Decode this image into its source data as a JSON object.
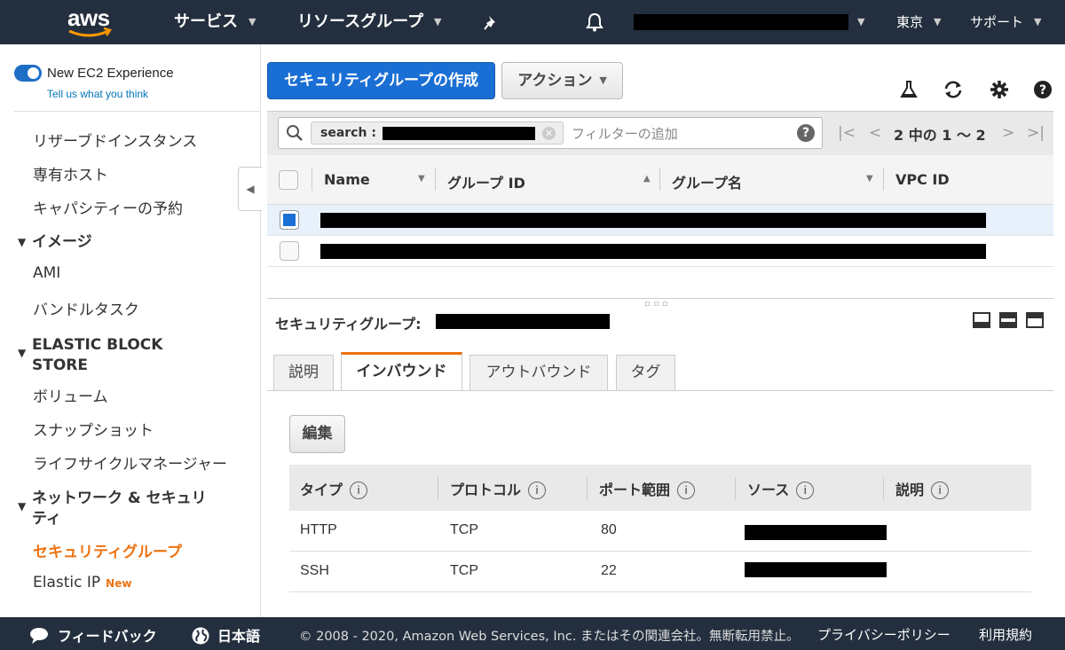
{
  "topnav": {
    "logo": "aws",
    "services": "サービス",
    "resource_groups": "リソースグループ",
    "region": "東京",
    "support": "サポート",
    "icons": [
      "pin-icon",
      "bell-icon"
    ]
  },
  "sidebar": {
    "experience_label": "New EC2 Experience",
    "experience_link": "Tell us what you think",
    "items": {
      "reserved": "リザーブドインスタンス",
      "dedicated": "専有ホスト",
      "capacity": "キャパシティーの予約",
      "images_head": "イメージ",
      "ami": "AMI",
      "bundle": "バンドルタスク",
      "ebs_head_1": "ELASTIC BLOCK",
      "ebs_head_2": "STORE",
      "volumes": "ボリューム",
      "snapshots": "スナップショット",
      "lifecycle": "ライフサイクルマネージャー",
      "netsec_head_1": "ネットワーク & セキュリ",
      "netsec_head_2": "ティ",
      "security_groups": "セキュリティグループ",
      "elastic_ip": "Elastic IP",
      "new_badge": "New"
    }
  },
  "toolbar": {
    "create_label": "セキュリティグループの作成",
    "actions_label": "アクション"
  },
  "filter": {
    "token_label": "search :",
    "placeholder": "フィルターの追加",
    "pager_text": "2 中の 1 ～ 2"
  },
  "grid": {
    "columns": [
      "Name",
      "グループ ID",
      "グループ名",
      "VPC ID"
    ],
    "row_count": 2
  },
  "detail": {
    "title": "セキュリティグループ:",
    "tabs": [
      "説明",
      "インバウンド",
      "アウトバウンド",
      "タグ"
    ],
    "active_tab": "インバウンド",
    "edit_label": "編集",
    "rule_headers": [
      "タイプ",
      "プロトコル",
      "ポート範囲",
      "ソース",
      "説明"
    ],
    "rules": [
      {
        "type": "HTTP",
        "protocol": "TCP",
        "port": "80"
      },
      {
        "type": "SSH",
        "protocol": "TCP",
        "port": "22"
      }
    ]
  },
  "footer": {
    "feedback": "フィードバック",
    "language": "日本語",
    "copyright": "© 2008 - 2020, Amazon Web Services, Inc. またはその関連会社。無断転用禁止。",
    "privacy": "プライバシーポリシー",
    "terms": "利用規約"
  },
  "colors": {
    "nav_bg": "#232f3e",
    "primary": "#1a6fd4",
    "accent": "#ec7211"
  }
}
